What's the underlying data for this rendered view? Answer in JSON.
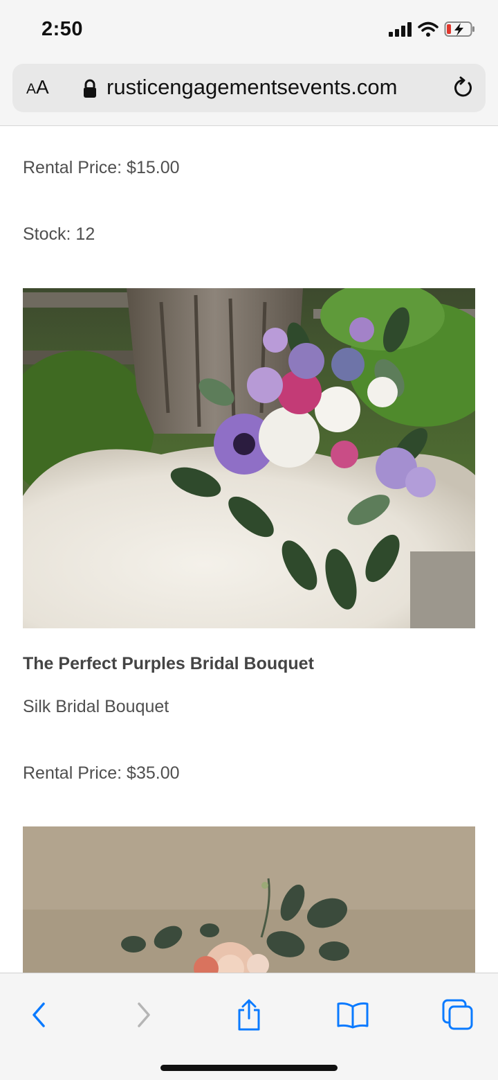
{
  "status_bar": {
    "time": "2:50"
  },
  "browser": {
    "text_size_label": "AA",
    "url": "rusticengagementsevents.com"
  },
  "content": {
    "prev_item": {
      "rental_price": "Rental Price: $15.00",
      "stock": "Stock: 12"
    },
    "item": {
      "title": "The Perfect Purples Bridal Bouquet",
      "subtitle": "Silk Bridal Bouquet",
      "rental_price": "Rental Price: $35.00"
    }
  },
  "colors": {
    "accent": "#0a7aff",
    "disabled": "#b5b5b5",
    "text": "#4f4f4f"
  }
}
